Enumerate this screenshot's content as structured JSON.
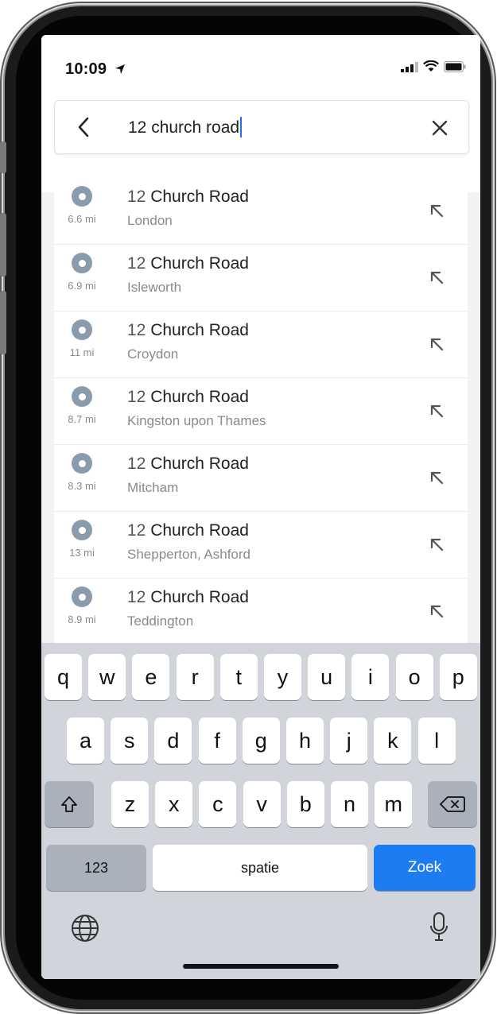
{
  "status_bar": {
    "time": "10:09"
  },
  "search": {
    "query": "12 church road"
  },
  "results": [
    {
      "distance": "6.6 mi",
      "title_num": "12",
      "title_name": "Church Road",
      "subtitle": "London"
    },
    {
      "distance": "6.9 mi",
      "title_num": "12",
      "title_name": "Church Road",
      "subtitle": "Isleworth"
    },
    {
      "distance": "11 mi",
      "title_num": "12",
      "title_name": "Church Road",
      "subtitle": "Croydon"
    },
    {
      "distance": "8.7 mi",
      "title_num": "12",
      "title_name": "Church Road",
      "subtitle": "Kingston upon Thames"
    },
    {
      "distance": "8.3 mi",
      "title_num": "12",
      "title_name": "Church Road",
      "subtitle": "Mitcham"
    },
    {
      "distance": "13 mi",
      "title_num": "12",
      "title_name": "Church Road",
      "subtitle": "Shepperton, Ashford"
    },
    {
      "distance": "8.9 mi",
      "title_num": "12",
      "title_name": "Church Road",
      "subtitle": "Teddington"
    }
  ],
  "keyboard": {
    "row1": [
      "q",
      "w",
      "e",
      "r",
      "t",
      "y",
      "u",
      "i",
      "o",
      "p"
    ],
    "row2": [
      "a",
      "s",
      "d",
      "f",
      "g",
      "h",
      "j",
      "k",
      "l"
    ],
    "row3": [
      "z",
      "x",
      "c",
      "v",
      "b",
      "n",
      "m"
    ],
    "numbers_label": "123",
    "space_label": "spatie",
    "go_label": "Zoek"
  },
  "colors": {
    "accent": "#1e7cf3",
    "pin": "#8a9bab",
    "keyboard_bg": "#d1d4da"
  }
}
